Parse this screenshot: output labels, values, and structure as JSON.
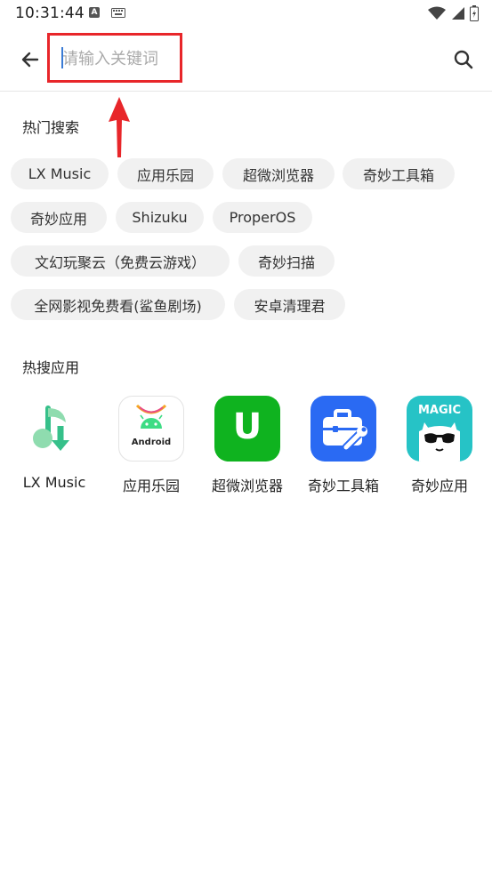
{
  "status_bar": {
    "time": "10:31:44"
  },
  "search": {
    "placeholder": "请输入关键词"
  },
  "hot_search": {
    "title": "热门搜索",
    "chips": [
      "LX Music",
      "应用乐园",
      "超微浏览器",
      "奇妙工具箱",
      "奇妙应用",
      "Shizuku",
      "ProperOS",
      "文幻玩聚云（免费云游戏）",
      "奇妙扫描",
      "全网影视免费看(鲨鱼剧场)",
      "安卓清理君"
    ]
  },
  "hot_apps": {
    "title": "热搜应用",
    "apps": [
      {
        "name": "LX Music",
        "icon": "lx-music-icon"
      },
      {
        "name": "应用乐园",
        "icon": "android-icon",
        "icon_text": "Android"
      },
      {
        "name": "超微浏览器",
        "icon": "u-browser-icon",
        "icon_text": "U"
      },
      {
        "name": "奇妙工具箱",
        "icon": "toolbox-icon"
      },
      {
        "name": "奇妙应用",
        "icon": "magic-app-icon",
        "icon_text": "MAGIC"
      }
    ]
  },
  "colors": {
    "highlight_red": "#e8262a",
    "chip_bg": "#f1f1f1",
    "browser_green": "#0fb31f",
    "toolbox_blue": "#2a6af3",
    "magic_teal": "#26c3c6"
  }
}
